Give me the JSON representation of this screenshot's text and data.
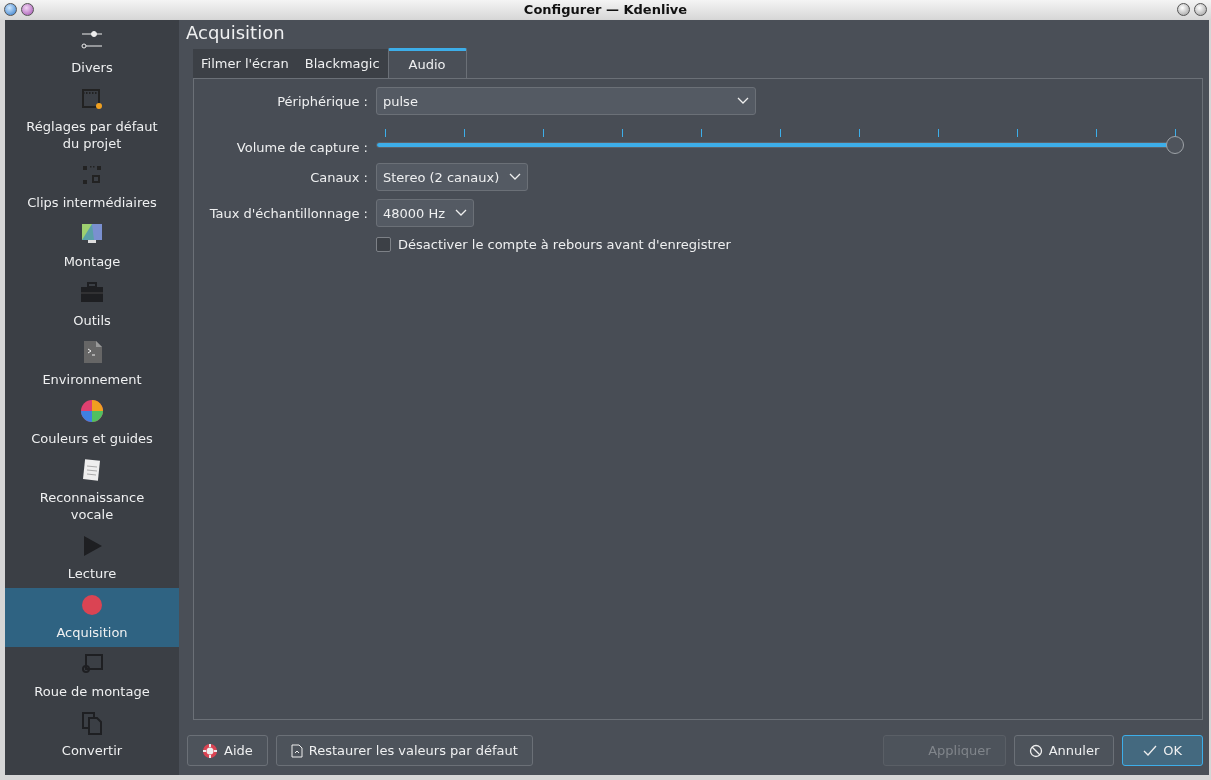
{
  "window": {
    "title": "Configurer — Kdenlive"
  },
  "sidebar": {
    "items": [
      {
        "label": "Divers",
        "selected": false
      },
      {
        "label": "Réglages par défaut du projet",
        "selected": false
      },
      {
        "label": "Clips intermédiaires",
        "selected": false
      },
      {
        "label": "Montage",
        "selected": false
      },
      {
        "label": "Outils",
        "selected": false
      },
      {
        "label": "Environnement",
        "selected": false
      },
      {
        "label": "Couleurs et guides",
        "selected": false
      },
      {
        "label": "Reconnaissance vocale",
        "selected": false
      },
      {
        "label": "Lecture",
        "selected": false
      },
      {
        "label": "Acquisition",
        "selected": true
      },
      {
        "label": "Roue de montage",
        "selected": false
      },
      {
        "label": "Convertir",
        "selected": false
      }
    ]
  },
  "page_title": "Acquisition",
  "tabs": [
    {
      "label": "Filmer l'écran",
      "selected": false
    },
    {
      "label": "Blackmagic",
      "selected": false
    },
    {
      "label": "Audio",
      "selected": true
    }
  ],
  "form": {
    "device": {
      "label": "Périphérique :",
      "value": "pulse"
    },
    "volume": {
      "label": "Volume de capture :",
      "level": 1.0
    },
    "channels": {
      "label": "Canaux :",
      "value": "Stereo (2 canaux)"
    },
    "sample_rate": {
      "label": "Taux d'échantillonnage :",
      "value": "48000 Hz"
    },
    "countdown": {
      "label": "Désactiver le compte à rebours avant d'enregistrer",
      "checked": false
    }
  },
  "buttons": [
    {
      "label": "Aide",
      "kind": "help",
      "disabled": false,
      "default": false
    },
    {
      "label": "Restaurer les valeurs par défaut",
      "kind": "restore",
      "disabled": false,
      "default": false
    },
    {
      "label": "Appliquer",
      "kind": "apply",
      "disabled": true,
      "default": false
    },
    {
      "label": "Annuler",
      "kind": "cancel",
      "disabled": false,
      "default": false
    },
    {
      "label": "OK",
      "kind": "ok",
      "disabled": false,
      "default": true
    }
  ]
}
